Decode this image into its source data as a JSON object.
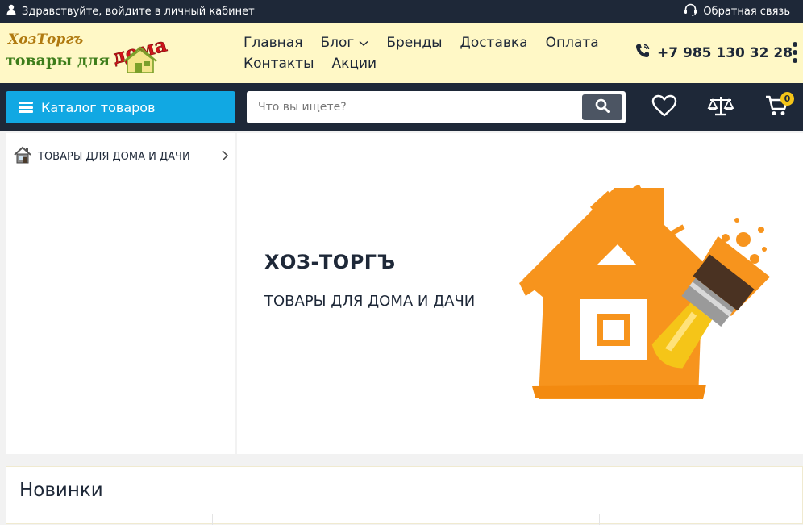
{
  "topbar": {
    "login_text": "Здравствуйте, войдите в личный кабинет",
    "feedback_text": "Обратная связь"
  },
  "logo": {
    "line1": "ХозТоргъ",
    "line2": "товары для",
    "line3": "дома"
  },
  "nav": {
    "items": [
      {
        "label": "Главная"
      },
      {
        "label": "Блог"
      },
      {
        "label": "Бренды"
      },
      {
        "label": "Доставка"
      },
      {
        "label": "Оплата"
      },
      {
        "label": "Контакты"
      },
      {
        "label": "Акции"
      }
    ]
  },
  "phone": {
    "number": "+7 985 130 32 28"
  },
  "catalog": {
    "label": "Каталог товаров"
  },
  "search": {
    "placeholder": "Что вы ищете?"
  },
  "cart": {
    "count": "0"
  },
  "sidebar": {
    "items": [
      {
        "label": "ТОВАРЫ ДЛЯ ДОМА И ДАЧИ"
      }
    ]
  },
  "banner": {
    "title": "ХОЗ-ТОРГЪ",
    "subtitle": "ТОВАРЫ ДЛЯ ДОМА И ДАЧИ"
  },
  "news": {
    "title": "Новинки"
  },
  "colors": {
    "dark": "#1e2838",
    "accent_blue": "#11a8e3",
    "header_bg": "#fff8c6",
    "orange": "#f7941d",
    "badge": "#f5c518"
  }
}
